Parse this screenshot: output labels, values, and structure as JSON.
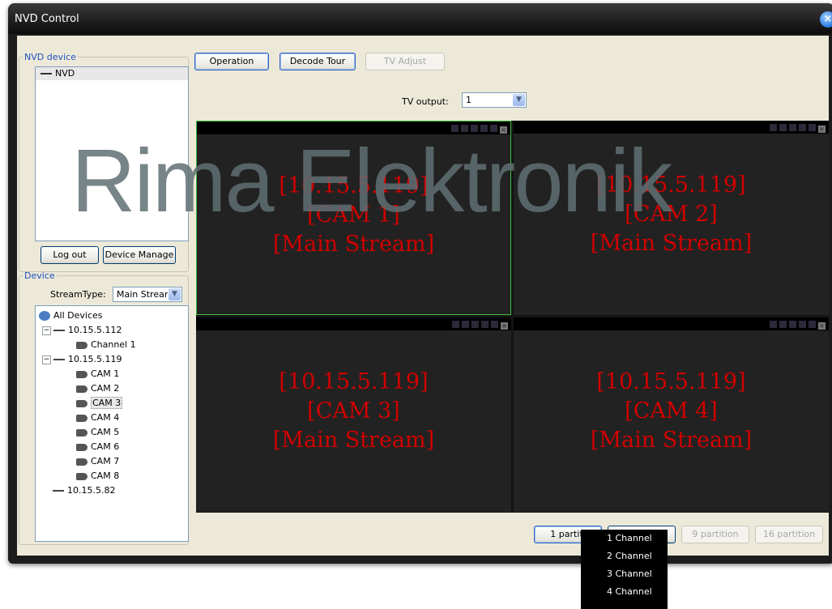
{
  "window": {
    "title": "NVD Control"
  },
  "nvd_device": {
    "legend": "NVD device",
    "items": [
      {
        "label": "NVD"
      }
    ],
    "logout_label": "Log out",
    "device_manage_label": "Device Manage"
  },
  "device": {
    "legend": "Device",
    "stream_type_label": "StreamType:",
    "stream_type_value": "Main Strear",
    "tree": {
      "root": "All Devices",
      "dev1": {
        "label": "10.15.5.112",
        "channels": [
          "Channel 1"
        ]
      },
      "dev2": {
        "label": "10.15.5.119",
        "channels": [
          "CAM 1",
          "CAM 2",
          "CAM 3",
          "CAM 4",
          "CAM 5",
          "CAM 6",
          "CAM 7",
          "CAM 8"
        ]
      },
      "dev3": {
        "label": "10.15.5.82"
      }
    }
  },
  "tabs": {
    "operation": "Operation",
    "decode_tour": "Decode Tour",
    "tv_adjust": "TV Adjust"
  },
  "tv_output": {
    "label": "TV output:",
    "value": "1"
  },
  "video_cells": [
    {
      "ip": "[10.15.5.119]",
      "cam": "[CAM 1]",
      "stream": "[Main Stream]"
    },
    {
      "ip": "[10.15.5.119]",
      "cam": "[CAM 2]",
      "stream": "[Main Stream]"
    },
    {
      "ip": "[10.15.5.119]",
      "cam": "[CAM 3]",
      "stream": "[Main Stream]"
    },
    {
      "ip": "[10.15.5.119]",
      "cam": "[CAM 4]",
      "stream": "[Main Stream]"
    }
  ],
  "partitions": {
    "p1": "1 partiti",
    "p4": "4 partiti",
    "p9": "9 partition",
    "p16": "16 partition"
  },
  "channel_menu": [
    "1 Channel",
    "2 Channel",
    "3 Channel",
    "4 Channel"
  ],
  "watermark": "Rima Elektronik"
}
